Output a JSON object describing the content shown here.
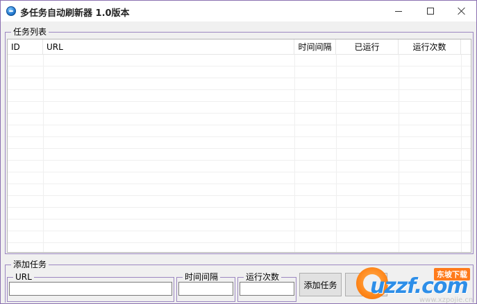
{
  "window": {
    "title": "多任务自动刷新器 1.0版本",
    "icon": "globe-refresh-icon"
  },
  "title_bar": {
    "minimize_icon": "minimize-icon",
    "maximize_icon": "maximize-icon",
    "close_icon": "close-icon"
  },
  "task_list": {
    "group_label": "任务列表",
    "columns": [
      "ID",
      "URL",
      "时间间隔",
      "已运行",
      "运行次数"
    ],
    "rows": []
  },
  "add_task": {
    "group_label": "添加任务",
    "url_label": "URL",
    "url_value": "",
    "interval_label": "时间间隔",
    "interval_value": "",
    "count_label": "运行次数",
    "count_value": "",
    "add_button_label": "添加任务"
  },
  "watermark": {
    "brand": "uzzf.com",
    "badge": "东坡下载",
    "url": "www.xzpojie.cn"
  },
  "colors": {
    "frame_border": "#8a6fb0",
    "group_border": "#9b86c1",
    "watermark_blue": "#2d8ee8",
    "watermark_orange": "#ff7a1a"
  }
}
